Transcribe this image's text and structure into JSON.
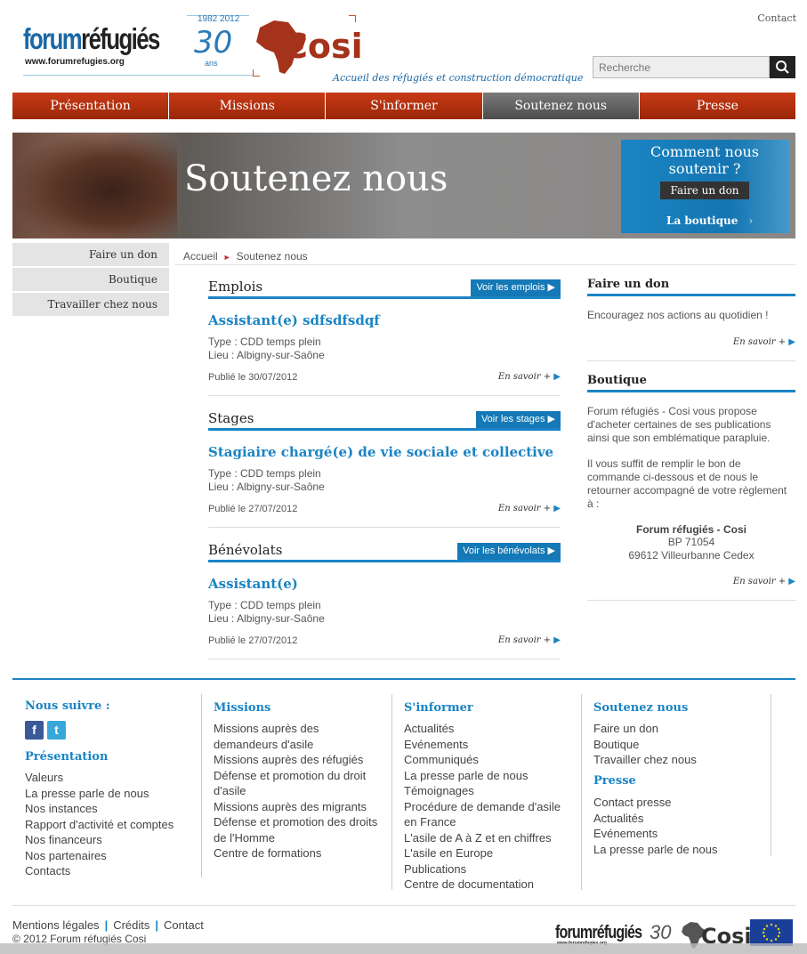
{
  "header": {
    "logo_forum": "forum",
    "logo_refugies": "réfugiés",
    "logo_url": "www.forumrefugies.org",
    "logo_years": "1982 2012",
    "logo_30": "30",
    "logo_ans": "ans",
    "logo_cosi": "Cosi",
    "cosi_tagline": "Accueil des réfugiés et construction démocratique",
    "contact_link": "Contact",
    "search_placeholder": "Recherche"
  },
  "nav": {
    "items": [
      {
        "label": "Présentation"
      },
      {
        "label": "Missions"
      },
      {
        "label": "S'informer"
      },
      {
        "label": "Soutenez nous",
        "active": true
      },
      {
        "label": "Presse"
      }
    ]
  },
  "banner": {
    "title": "Soutenez nous",
    "promo_title": "Comment nous soutenir ?",
    "promo_button": "Faire un don",
    "promo_shop": "La boutique",
    "promo_shop_arrow": "›"
  },
  "left_menu": {
    "items": [
      {
        "label": "Faire un don"
      },
      {
        "label": "Boutique"
      },
      {
        "label": "Travailler chez nous"
      }
    ]
  },
  "breadcrumb": {
    "home": "Accueil",
    "separator": "►",
    "current": "Soutenez nous"
  },
  "sections": [
    {
      "title": "Emplois",
      "button": "Voir les emplois ▶",
      "item": {
        "title": "Assistant(e) sdfsdfsdqf",
        "type": "Type : CDD temps plein",
        "place": "Lieu : Albigny-sur-Saône",
        "published": "Publié le 30/07/2012",
        "more": "En savoir +",
        "arrow": "▶"
      }
    },
    {
      "title": "Stages",
      "button": "Voir les stages ▶",
      "item": {
        "title": "Stagiaire chargé(e) de vie sociale et collective",
        "type": "Type : CDD temps plein",
        "place": "Lieu : Albigny-sur-Saône",
        "published": "Publié le 27/07/2012",
        "more": "En savoir +",
        "arrow": "▶"
      }
    },
    {
      "title": "Bénévolats",
      "button": "Voir les bénévolats ▶",
      "item": {
        "title": "Assistant(e)",
        "type": "Type : CDD temps plein",
        "place": "Lieu : Albigny-sur-Saône",
        "published": "Publié le 27/07/2012",
        "more": "En savoir +",
        "arrow": "▶"
      }
    }
  ],
  "right": {
    "don_title": "Faire un don",
    "don_text": "Encouragez nos actions au quotidien !",
    "more": "En savoir +",
    "arrow": "▶",
    "shop_title": "Boutique",
    "shop_text1": "Forum réfugiés - Cosi vous propose d'acheter certaines de ses publications ainsi que son emblématique parapluie.",
    "shop_text2": "Il vous suffit de remplir le bon de commande ci-dessous et de nous le retourner accompagné de votre règlement à :",
    "addr_name": "Forum réfugiés - Cosi",
    "addr_bp": "BP 71054",
    "addr_city": "69612 Villeurbanne Cedex"
  },
  "footer": {
    "follow": "Nous suivre :",
    "facebook_glyph": "f",
    "twitter_glyph": "t",
    "col1_head": "Présentation",
    "col1": [
      "Valeurs",
      "La presse parle de nous",
      "Nos instances",
      "Rapport d'activité et comptes",
      "Nos financeurs",
      "Nos partenaires",
      "Contacts"
    ],
    "col2_head": "Missions",
    "col2": [
      "Missions auprès des demandeurs d'asile",
      "Missions auprès des réfugiés",
      "Défense et promotion du droit d'asile",
      "Missions auprès des migrants",
      "Défense et promotion des droits de l'Homme",
      "Centre de formations"
    ],
    "col3_head": "S'informer",
    "col3": [
      "Actualités",
      "Evénements",
      "Communiqués",
      "La presse parle de nous",
      "Témoignages",
      "Procédure de demande d'asile en France",
      "L'asile de A à Z et en chiffres",
      "L'asile en Europe",
      "Publications",
      "Centre de documentation"
    ],
    "col4_head": "Soutenez nous",
    "col4": [
      "Faire un don",
      "Boutique",
      "Travailler chez nous"
    ],
    "col4b_head": "Presse",
    "col4b": [
      "Contact presse",
      "Actualités",
      "Evénements",
      "La presse parle de nous"
    ],
    "legal": [
      "Mentions légales",
      "Crédits",
      "Contact"
    ],
    "legal_sep": "|",
    "copyright": "© 2012 Forum réfugiés Cosi",
    "logo_forum": "forum",
    "logo_refugies": "réfugiés",
    "logo_url": "www.forumrefugies.org",
    "logo_30": "30",
    "logo_cosi": "Cosi"
  },
  "colors": {
    "nav_red": "#b32f10",
    "accent_blue": "#1a84c4",
    "active_grey": "#5a5a5a"
  }
}
